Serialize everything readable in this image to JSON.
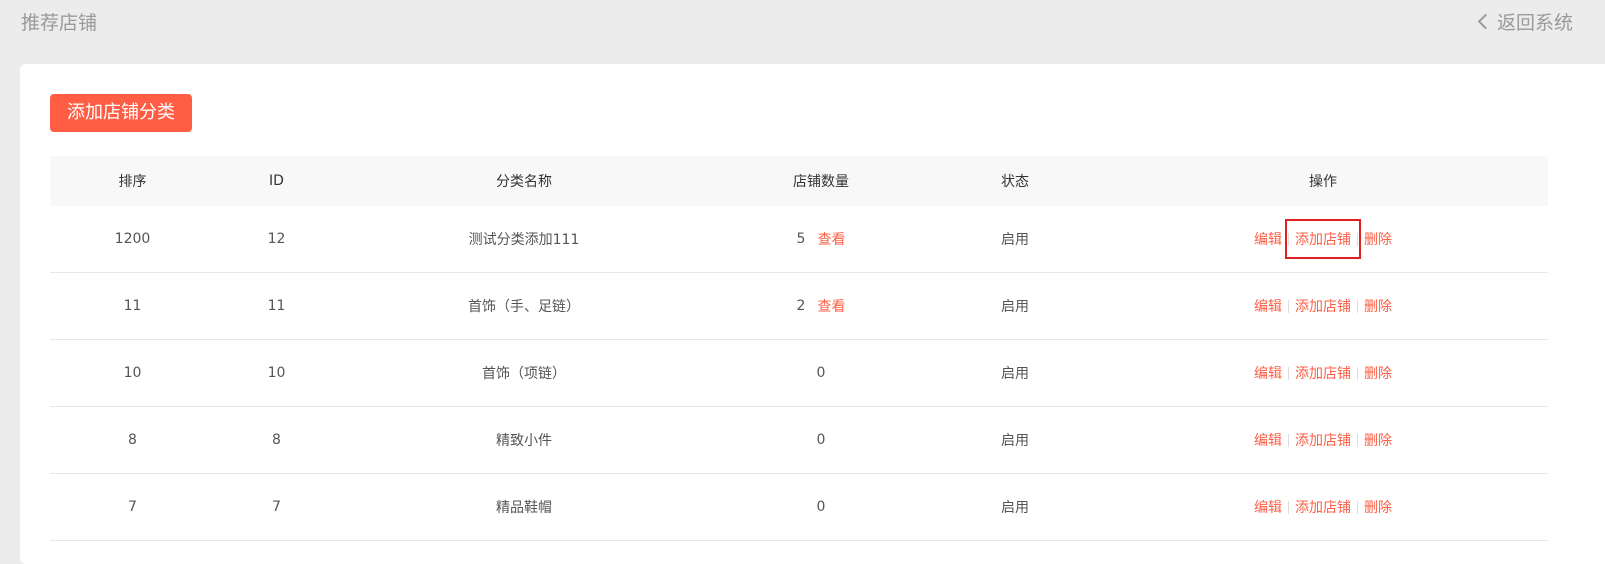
{
  "header": {
    "title": "推荐店铺",
    "back_label": "返回系统"
  },
  "toolbar": {
    "add_category_label": "添加店铺分类"
  },
  "table": {
    "columns": [
      "排序",
      "ID",
      "分类名称",
      "店铺数量",
      "状态",
      "操作"
    ],
    "view_label": "查看",
    "actions": {
      "edit": "编辑",
      "add_shop": "添加店铺",
      "delete": "删除"
    },
    "rows": [
      {
        "sort": "1200",
        "id": "12",
        "name": "测试分类添加111",
        "count": "5",
        "status": "启用"
      },
      {
        "sort": "11",
        "id": "11",
        "name": "首饰（手、足链）",
        "count": "2",
        "status": "启用"
      },
      {
        "sort": "10",
        "id": "10",
        "name": "首饰（项链）",
        "count": "0",
        "status": "启用"
      },
      {
        "sort": "8",
        "id": "8",
        "name": "精致小件",
        "count": "0",
        "status": "启用"
      },
      {
        "sort": "7",
        "id": "7",
        "name": "精品鞋帽",
        "count": "0",
        "status": "启用"
      }
    ]
  },
  "colors": {
    "accent": "#ff5e45",
    "highlight": "#e02020",
    "background": "#ececec"
  }
}
